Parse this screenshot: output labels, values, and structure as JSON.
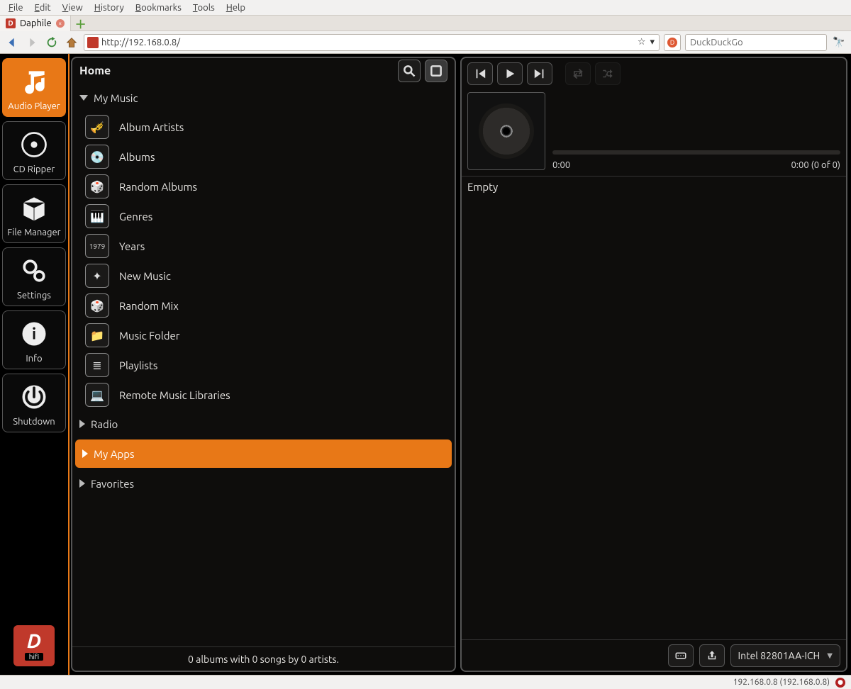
{
  "browser": {
    "menus": [
      "File",
      "Edit",
      "View",
      "History",
      "Bookmarks",
      "Tools",
      "Help"
    ],
    "tab_title": "Daphile",
    "url_display": "http://192.168.0.8/",
    "search_placeholder": "DuckDuckGo"
  },
  "sidebar": {
    "items": [
      {
        "label": "Audio Player"
      },
      {
        "label": "CD Ripper"
      },
      {
        "label": "File Manager"
      },
      {
        "label": "Settings"
      },
      {
        "label": "Info"
      },
      {
        "label": "Shutdown"
      }
    ],
    "logo_sub": "hifi"
  },
  "library": {
    "title": "Home",
    "section_my_music": "My Music",
    "items": [
      "Album Artists",
      "Albums",
      "Random Albums",
      "Genres",
      "Years",
      "New Music",
      "Random Mix",
      "Music Folder",
      "Playlists",
      "Remote Music Libraries"
    ],
    "section_radio": "Radio",
    "section_my_apps": "My Apps",
    "section_favorites": "Favorites",
    "footer": "0 albums with 0 songs by 0 artists."
  },
  "player": {
    "elapsed": "0:00",
    "remaining": "0:00  (0 of 0)",
    "queue_label": "Empty",
    "device": "Intel 82801AA-ICH"
  },
  "status_text": "192.168.0.8 (192.168.0.8)"
}
